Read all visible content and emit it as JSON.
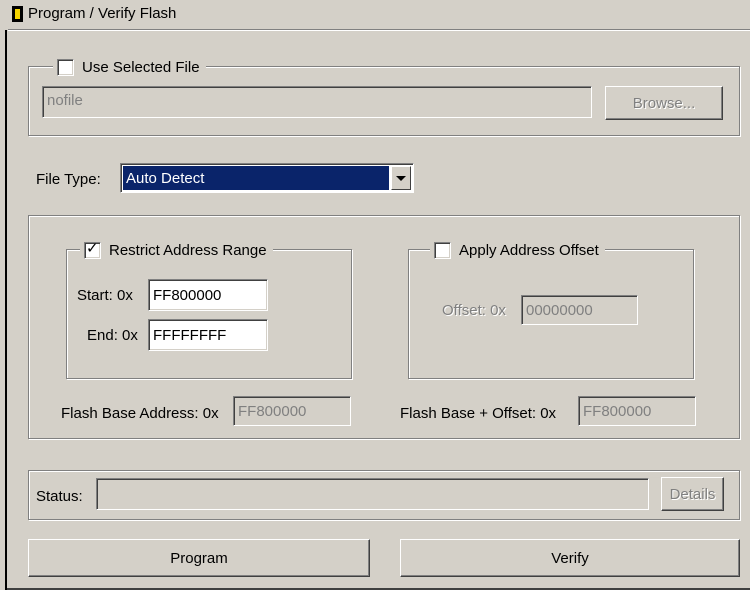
{
  "window": {
    "title": "Program / Verify Flash",
    "icon": "flash-chip-icon"
  },
  "file_group": {
    "use_selected_file_label": "Use Selected File",
    "use_selected_file_checked": false,
    "file_path_value": "nofile",
    "browse_label": "Browse..."
  },
  "file_type": {
    "label": "File Type:",
    "selected": "Auto Detect"
  },
  "restrict": {
    "label": "Restrict Address Range",
    "checked": true,
    "start_label": "Start: 0x",
    "start_value": "FF800000",
    "end_label": "End: 0x",
    "end_value": "FFFFFFFF"
  },
  "offset": {
    "label": "Apply Address Offset",
    "checked": false,
    "offset_label": "Offset: 0x",
    "offset_value": "00000000"
  },
  "flash_base": {
    "label": "Flash Base Address: 0x",
    "value": "FF800000"
  },
  "flash_base_offset": {
    "label": "Flash Base + Offset: 0x",
    "value": "FF800000"
  },
  "status": {
    "label": "Status:",
    "value": "",
    "details_label": "Details"
  },
  "actions": {
    "program_label": "Program",
    "verify_label": "Verify"
  },
  "colors": {
    "face": "#d4d0c8",
    "selection": "#0a246a",
    "icon_yellow": "#f4d400"
  }
}
